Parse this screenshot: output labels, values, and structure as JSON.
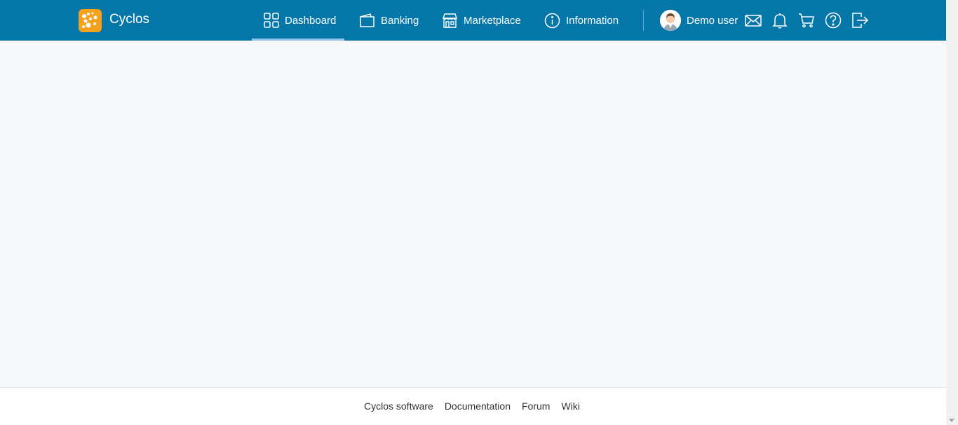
{
  "header": {
    "brand": "Cyclos",
    "nav": [
      {
        "label": "Dashboard",
        "icon": "dashboard-grid-icon",
        "active": true
      },
      {
        "label": "Banking",
        "icon": "wallet-icon",
        "active": false
      },
      {
        "label": "Marketplace",
        "icon": "store-icon",
        "active": false
      },
      {
        "label": "Information",
        "icon": "info-icon",
        "active": false
      }
    ],
    "user": {
      "name": "Demo user",
      "icon": "avatar"
    },
    "actions": [
      "mail-icon",
      "bell-icon",
      "cart-icon",
      "help-icon",
      "logout-icon"
    ]
  },
  "footer": {
    "links": [
      "Cyclos software",
      "Documentation",
      "Forum",
      "Wiki"
    ]
  },
  "colors": {
    "header_bg": "#0576a8",
    "active_underline": "#8ec5e6",
    "logo_orange": "#f7a11a",
    "content_bg": "#f7f8fa"
  }
}
